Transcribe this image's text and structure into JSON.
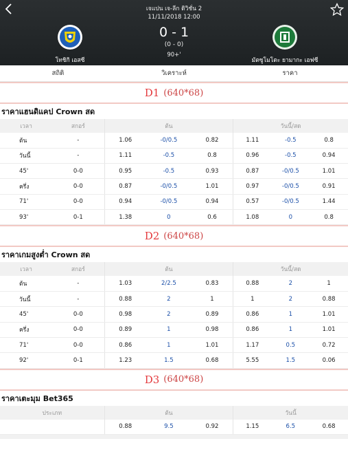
{
  "header": {
    "league": "เจแปน เจ-ลีก ดิวิชั่น 2",
    "datetime": "11/11/2018 12:00",
    "score": "0 - 1",
    "halftime": "(0 - 0)",
    "minute": "90+'",
    "home_team": "โทชิกิ เอสซี",
    "away_team": "มัตซูโมโตะ ยามากะ เอฟซี",
    "home_color": "#1f5fb8",
    "away_color": "#1d7a3a"
  },
  "tabs": [
    {
      "label": "สถิติ"
    },
    {
      "label": "วิเคราะห์"
    },
    {
      "label": "ราคา"
    }
  ],
  "ads": [
    {
      "label": "D1",
      "size": "(640*68)"
    },
    {
      "label": "D2",
      "size": "(640*68)"
    },
    {
      "label": "D3",
      "size": "(640*68)"
    }
  ],
  "handicap": {
    "title": "ราคาแฮนดิแคป Crown สด",
    "headers": {
      "time": "เวลา",
      "score": "สกอร์",
      "early": "ต้น",
      "live": "วันนี้/สด"
    },
    "rows": [
      [
        "ต้น",
        "-",
        "1.06",
        "-0/0.5",
        "0.82",
        "1.11",
        "-0.5",
        "0.8"
      ],
      [
        "วันนี้",
        "-",
        "1.11",
        "-0.5",
        "0.8",
        "0.96",
        "-0.5",
        "0.94"
      ],
      [
        "45'",
        "0-0",
        "0.95",
        "-0.5",
        "0.93",
        "0.87",
        "-0/0.5",
        "1.01"
      ],
      [
        "ครึ่ง",
        "0-0",
        "0.87",
        "-0/0.5",
        "1.01",
        "0.97",
        "-0/0.5",
        "0.91"
      ],
      [
        "71'",
        "0-0",
        "0.94",
        "-0/0.5",
        "0.94",
        "0.57",
        "-0/0.5",
        "1.44"
      ],
      [
        "93'",
        "0-1",
        "1.38",
        "0",
        "0.6",
        "1.08",
        "0",
        "0.8"
      ]
    ]
  },
  "overunder": {
    "title": "ราคาเกมสูงต่ำ Crown สด",
    "headers": {
      "time": "เวลา",
      "score": "สกอร์",
      "early": "ต้น",
      "live": "วันนี้/สด"
    },
    "rows": [
      [
        "ต้น",
        "-",
        "1.03",
        "2/2.5",
        "0.83",
        "0.88",
        "2",
        "1"
      ],
      [
        "วันนี้",
        "-",
        "0.88",
        "2",
        "1",
        "1",
        "2",
        "0.88"
      ],
      [
        "45'",
        "0-0",
        "0.98",
        "2",
        "0.89",
        "0.86",
        "1",
        "1.01"
      ],
      [
        "ครึ่ง",
        "0-0",
        "0.89",
        "1",
        "0.98",
        "0.86",
        "1",
        "1.01"
      ],
      [
        "71'",
        "0-0",
        "0.86",
        "1",
        "1.01",
        "1.17",
        "0.5",
        "0.72"
      ],
      [
        "92'",
        "0-1",
        "1.23",
        "1.5",
        "0.68",
        "5.55",
        "1.5",
        "0.06"
      ]
    ]
  },
  "corner": {
    "title": "ราคาเตะมุม Bet365",
    "headers": {
      "type": "ประเภท",
      "early": "ต้น",
      "today": "วันนี้"
    },
    "rows": [
      [
        "",
        "0.88",
        "9.5",
        "0.92",
        "1.15",
        "6.5",
        "0.68"
      ]
    ]
  }
}
